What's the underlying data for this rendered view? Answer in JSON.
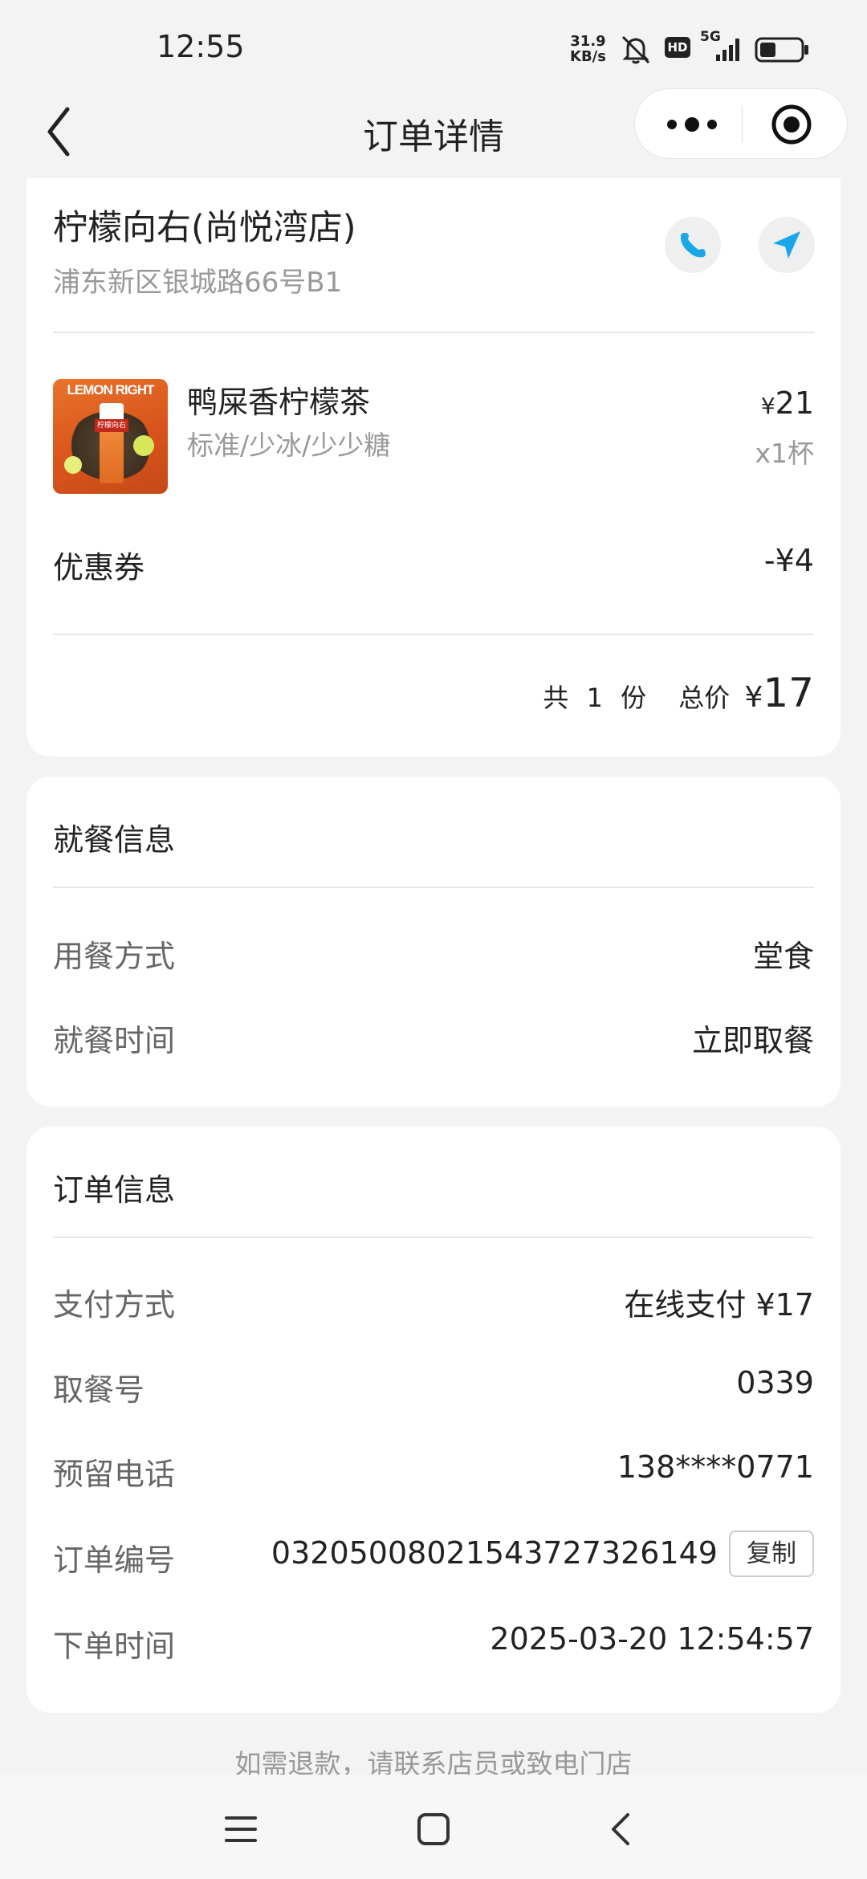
{
  "status_bar": {
    "time": "12:55",
    "net_speed_value": "31.9",
    "net_speed_unit": "KB/s",
    "hd_badge": "HD",
    "network": "5G",
    "battery_level": 0.4
  },
  "nav": {
    "title": "订单详情"
  },
  "store": {
    "name": "柠檬向右(尚悦湾店)",
    "address": "浦东新区银城路66号B1",
    "phone_icon": "phone-icon",
    "navigate_icon": "navigation-arrow-icon",
    "accent_color": "#1aa7e8"
  },
  "product": {
    "image_brand_text": "LEMON RIGHT",
    "image_badge_text": "柠檬向右",
    "name": "鸭屎香柠檬茶",
    "spec": "标准/少冰/少少糖",
    "price_symbol": "¥",
    "price": "21",
    "quantity": "x1杯"
  },
  "coupon": {
    "label": "优惠券",
    "value": "-¥4"
  },
  "summary": {
    "count_prefix": "共",
    "count": "1",
    "count_suffix": "份",
    "total_label": "总价",
    "total_symbol": "¥",
    "total": "17"
  },
  "dining": {
    "section_title": "就餐信息",
    "rows": [
      {
        "label": "用餐方式",
        "value": "堂食"
      },
      {
        "label": "就餐时间",
        "value": "立即取餐"
      }
    ]
  },
  "order": {
    "section_title": "订单信息",
    "rows": [
      {
        "label": "支付方式",
        "value": "在线支付 ¥17"
      },
      {
        "label": "取餐号",
        "value": "0339"
      },
      {
        "label": "预留电话",
        "value": "138****0771"
      },
      {
        "label": "订单编号",
        "value": "03205008021543727326149"
      },
      {
        "label": "下单时间",
        "value": "2025-03-20 12:54:57"
      }
    ],
    "copy_label": "复制"
  },
  "footer": {
    "hint_prefix": "如需退款，请",
    "hint_link": "联系店员或致电门店"
  }
}
